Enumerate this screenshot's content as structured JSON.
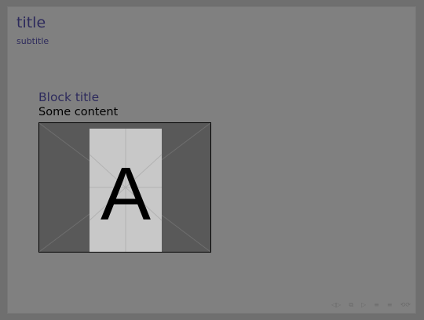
{
  "frame": {
    "title": "title",
    "subtitle": "subtitle"
  },
  "block": {
    "title": "Block title",
    "content": "Some content"
  },
  "image": {
    "letter": "A"
  },
  "navigation": {
    "icons": [
      "nav-first-icon",
      "nav-frame-icon",
      "nav-prev-section-icon",
      "nav-next-section-icon",
      "nav-subsection-icon",
      "nav-search-icon"
    ]
  },
  "colors": {
    "background": "#808080",
    "title": "#2d2a5c",
    "text": "#000000",
    "image_panel": "#c8c8c8",
    "image_bg": "#595959"
  }
}
